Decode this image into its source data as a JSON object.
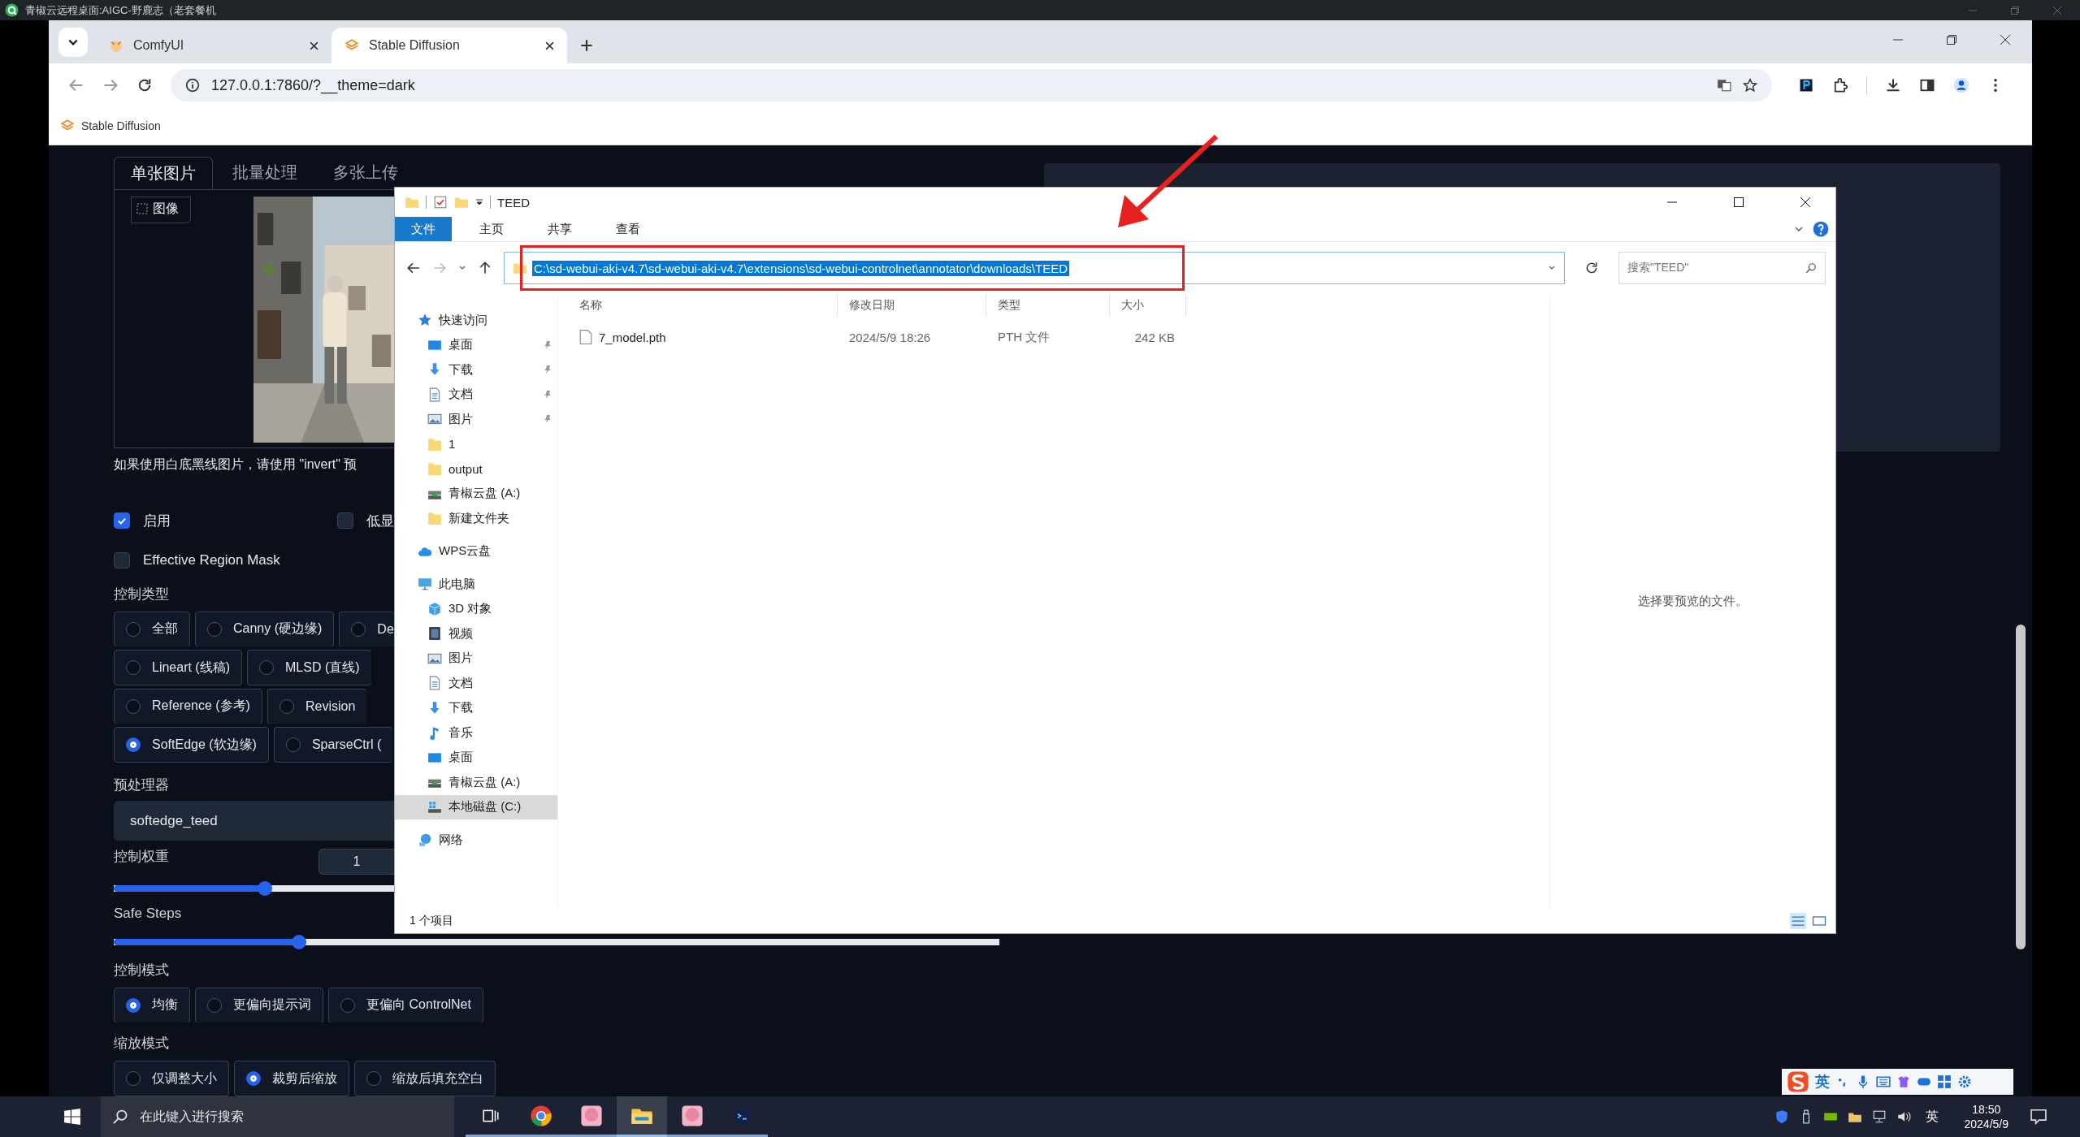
{
  "remote_desktop": {
    "title": "青椒云远程桌面:AIGC-野鹿志（老套餐机"
  },
  "browser": {
    "tabs": [
      {
        "title": "ComfyUI",
        "kind": "comfy",
        "selected": false
      },
      {
        "title": "Stable Diffusion",
        "kind": "gradio",
        "selected": true
      }
    ],
    "url": "127.0.0.1:7860/?__theme=dark",
    "bookmarks": [
      {
        "title": "Stable Diffusion"
      }
    ]
  },
  "webui": {
    "image_tabs": [
      {
        "label": "单张图片",
        "selected": true
      },
      {
        "label": "批量处理",
        "selected": false
      },
      {
        "label": "多张上传",
        "selected": false
      }
    ],
    "image_label": "图像",
    "hint": "如果使用白底黑线图片，请使用 \"invert\" 预",
    "toggles": [
      [
        {
          "label": "启用",
          "checked": true
        },
        {
          "label": "低显",
          "checked": false
        }
      ],
      [
        {
          "label": "Effective Region Mask",
          "checked": false
        }
      ]
    ],
    "control_type": {
      "label": "控制类型",
      "rows": [
        [
          {
            "label": "全部",
            "selected": false
          },
          {
            "label": "Canny (硬边缘)",
            "selected": false
          },
          {
            "label": "De",
            "selected": false
          }
        ],
        [
          {
            "label": "Lineart (线稿)",
            "selected": false
          },
          {
            "label": "MLSD (直线)",
            "selected": false
          }
        ],
        [
          {
            "label": "Reference (参考)",
            "selected": false
          },
          {
            "label": "Revision",
            "selected": false
          }
        ],
        [
          {
            "label": "SoftEdge (软边缘)",
            "selected": true
          },
          {
            "label": "SparseCtrl (",
            "selected": false
          }
        ]
      ]
    },
    "preprocessor": {
      "label": "预处理器",
      "value": "softedge_teed"
    },
    "control_weight": {
      "label": "控制权重",
      "value": "1",
      "level": 0.165
    },
    "safe_steps": {
      "label": "Safe Steps",
      "level": 0.204
    },
    "control_mode": {
      "label": "控制模式",
      "options": [
        {
          "label": "均衡",
          "selected": true
        },
        {
          "label": "更偏向提示词",
          "selected": false
        },
        {
          "label": "更偏向 ControlNet",
          "selected": false
        }
      ]
    },
    "resize_mode": {
      "label": "缩放模式",
      "options": [
        {
          "label": "仅调整大小",
          "selected": false
        },
        {
          "label": "裁剪后缩放",
          "selected": true
        },
        {
          "label": "缩放后填充空白",
          "selected": false
        }
      ]
    }
  },
  "explorer": {
    "title": "TEED",
    "ribbon_tabs": [
      {
        "label": "文件",
        "selected": true
      },
      {
        "label": "主页",
        "selected": false
      },
      {
        "label": "共享",
        "selected": false
      },
      {
        "label": "查看",
        "selected": false
      }
    ],
    "address": "C:\\sd-webui-aki-v4.7\\sd-webui-aki-v4.7\\extensions\\sd-webui-controlnet\\annotator\\downloads\\TEED",
    "address_selected": true,
    "search": {
      "placeholder": "搜索\"TEED\""
    },
    "nav": [
      {
        "label": "快速访问",
        "kind": "star",
        "selected": false,
        "children": [
          {
            "label": "桌面",
            "kind": "desktop",
            "pinned": true,
            "selected": false
          },
          {
            "label": "下载",
            "kind": "download",
            "pinned": true,
            "selected": false
          },
          {
            "label": "文档",
            "kind": "document",
            "pinned": true,
            "selected": false
          },
          {
            "label": "图片",
            "kind": "picture",
            "pinned": true,
            "selected": false
          },
          {
            "label": "1",
            "kind": "folder",
            "pinned": false,
            "selected": false
          },
          {
            "label": "output",
            "kind": "folder",
            "pinned": false,
            "selected": false
          },
          {
            "label": "青椒云盘 (A:)",
            "kind": "drive",
            "pinned": false,
            "selected": false
          },
          {
            "label": "新建文件夹",
            "kind": "folder",
            "pinned": false,
            "selected": false
          }
        ]
      },
      {
        "label": "WPS云盘",
        "kind": "cloud",
        "selected": false
      },
      {
        "label": "此电脑",
        "kind": "pc",
        "selected": false,
        "children": [
          {
            "label": "3D 对象",
            "kind": "cube",
            "selected": false
          },
          {
            "label": "视频",
            "kind": "video",
            "selected": false
          },
          {
            "label": "图片",
            "kind": "picture",
            "selected": false
          },
          {
            "label": "文档",
            "kind": "document",
            "selected": false
          },
          {
            "label": "下载",
            "kind": "download",
            "selected": false
          },
          {
            "label": "音乐",
            "kind": "music",
            "selected": false
          },
          {
            "label": "桌面",
            "kind": "desktop",
            "selected": false
          },
          {
            "label": "青椒云盘 (A:)",
            "kind": "drive",
            "selected": false
          },
          {
            "label": "本地磁盘 (C:)",
            "kind": "localdisk",
            "selected": true
          }
        ]
      },
      {
        "label": "网络",
        "kind": "network",
        "selected": false
      }
    ],
    "columns": [
      "名称",
      "修改日期",
      "类型",
      "大小"
    ],
    "files": [
      {
        "name": "7_model.pth",
        "modified": "2024/5/9 18:26",
        "type": "PTH 文件",
        "size": "242 KB"
      }
    ],
    "preview_hint": "选择要预览的文件。",
    "status": "1 个项目"
  },
  "ime_toolbar": {
    "mode": "英"
  },
  "taskbar": {
    "search_placeholder": "在此键入进行搜索",
    "apps": [
      {
        "kind": "taskview",
        "active": false
      },
      {
        "kind": "chrome",
        "active": false
      },
      {
        "kind": "avatar",
        "active": false
      },
      {
        "kind": "explorer",
        "active": true
      },
      {
        "kind": "avatar",
        "active": false
      },
      {
        "kind": "terminal",
        "active": false
      }
    ],
    "input_mode": "英",
    "time": "18:50",
    "date": "2024/5/9"
  }
}
